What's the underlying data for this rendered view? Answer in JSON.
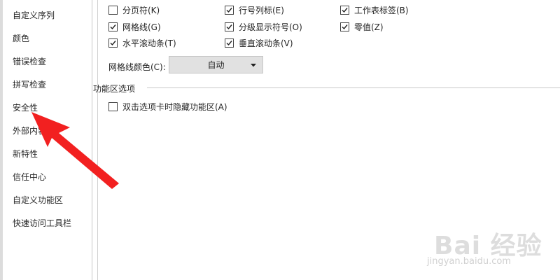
{
  "sidebar": {
    "items": [
      {
        "label": "自定义序列"
      },
      {
        "label": "颜色"
      },
      {
        "label": "错误检查"
      },
      {
        "label": "拼写检查"
      },
      {
        "label": "安全性"
      },
      {
        "label": "外部内容"
      },
      {
        "label": "新特性"
      },
      {
        "label": "信任中心"
      },
      {
        "label": "自定义功能区"
      },
      {
        "label": "快速访问工具栏"
      }
    ]
  },
  "view_options": {
    "page_break": {
      "label": "分页符(K)",
      "checked": false
    },
    "row_col_headers": {
      "label": "行号列标(E)",
      "checked": true
    },
    "sheet_tabs": {
      "label": "工作表标签(B)",
      "checked": true
    },
    "gridlines": {
      "label": "网格线(G)",
      "checked": true
    },
    "outline_symbols": {
      "label": "分级显示符号(O)",
      "checked": true
    },
    "zero_values": {
      "label": "零值(Z)",
      "checked": true
    },
    "h_scrollbar": {
      "label": "水平滚动条(T)",
      "checked": true
    },
    "v_scrollbar": {
      "label": "垂直滚动条(V)",
      "checked": true
    },
    "gridline_color_label": "网格线颜色(C):",
    "gridline_color_value": "自动"
  },
  "ribbon_options": {
    "section_title": "功能区选项",
    "hide_ribbon_on_dblclick": {
      "label": "双击选项卡时隐藏功能区(A)",
      "checked": false
    }
  },
  "annotation": {
    "arrow_color": "#f22020"
  },
  "watermark": {
    "text": "Bai 经验",
    "url": "jingyan.baidu.com"
  }
}
